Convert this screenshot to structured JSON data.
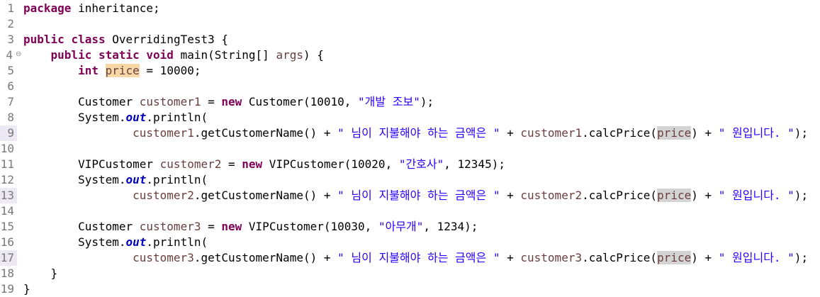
{
  "editor": {
    "lines": [
      {
        "num": "1",
        "tokens": [
          {
            "t": "package",
            "c": "kw"
          },
          {
            "t": " inheritance;",
            "c": ""
          }
        ]
      },
      {
        "num": "2",
        "tokens": []
      },
      {
        "num": "3",
        "tokens": [
          {
            "t": "public",
            "c": "kw"
          },
          {
            "t": " ",
            "c": ""
          },
          {
            "t": "class",
            "c": "kw"
          },
          {
            "t": " OverridingTest3 {",
            "c": ""
          }
        ]
      },
      {
        "num": "4",
        "fold": "⊖",
        "tokens": [
          {
            "t": "    ",
            "c": ""
          },
          {
            "t": "public",
            "c": "kw"
          },
          {
            "t": " ",
            "c": ""
          },
          {
            "t": "static",
            "c": "kw"
          },
          {
            "t": " ",
            "c": ""
          },
          {
            "t": "void",
            "c": "kw"
          },
          {
            "t": " main(String[] ",
            "c": ""
          },
          {
            "t": "args",
            "c": "var"
          },
          {
            "t": ") {",
            "c": ""
          }
        ]
      },
      {
        "num": "5",
        "tokens": [
          {
            "t": "        ",
            "c": ""
          },
          {
            "t": "int",
            "c": "kw"
          },
          {
            "t": " ",
            "c": ""
          },
          {
            "t": "price",
            "c": "var hl-decl"
          },
          {
            "t": " = 10000;",
            "c": ""
          }
        ]
      },
      {
        "num": "6",
        "tokens": []
      },
      {
        "num": "7",
        "tokens": [
          {
            "t": "        Customer ",
            "c": ""
          },
          {
            "t": "customer1",
            "c": "var"
          },
          {
            "t": " = ",
            "c": ""
          },
          {
            "t": "new",
            "c": "kw"
          },
          {
            "t": " Customer(10010, ",
            "c": ""
          },
          {
            "t": "\"개발 조보\"",
            "c": "str"
          },
          {
            "t": ");",
            "c": ""
          }
        ]
      },
      {
        "num": "8",
        "tokens": [
          {
            "t": "        System.",
            "c": ""
          },
          {
            "t": "out",
            "c": "fld"
          },
          {
            "t": ".println(",
            "c": ""
          }
        ]
      },
      {
        "num": "9",
        "marker": "full",
        "tokens": [
          {
            "t": "                ",
            "c": ""
          },
          {
            "t": "customer1",
            "c": "var"
          },
          {
            "t": ".getCustomerName() + ",
            "c": ""
          },
          {
            "t": "\" 님이 지불해야 하는 금액은 \"",
            "c": "str"
          },
          {
            "t": " + ",
            "c": ""
          },
          {
            "t": "customer1",
            "c": "var"
          },
          {
            "t": ".calcPrice(",
            "c": ""
          },
          {
            "t": "price",
            "c": "var hl"
          },
          {
            "t": ") + ",
            "c": ""
          },
          {
            "t": "\" 원입니다. \"",
            "c": "str"
          },
          {
            "t": ");",
            "c": ""
          }
        ]
      },
      {
        "num": "10",
        "tokens": []
      },
      {
        "num": "11",
        "tokens": [
          {
            "t": "        VIPCustomer ",
            "c": ""
          },
          {
            "t": "customer2",
            "c": "var"
          },
          {
            "t": " = ",
            "c": ""
          },
          {
            "t": "new",
            "c": "kw"
          },
          {
            "t": " VIPCustomer(10020, ",
            "c": ""
          },
          {
            "t": "\"간호사\"",
            "c": "str"
          },
          {
            "t": ", 12345);",
            "c": ""
          }
        ]
      },
      {
        "num": "12",
        "tokens": [
          {
            "t": "        System.",
            "c": ""
          },
          {
            "t": "out",
            "c": "fld"
          },
          {
            "t": ".println(",
            "c": ""
          }
        ]
      },
      {
        "num": "13",
        "marker": "full",
        "tokens": [
          {
            "t": "                ",
            "c": ""
          },
          {
            "t": "customer2",
            "c": "var"
          },
          {
            "t": ".getCustomerName() + ",
            "c": ""
          },
          {
            "t": "\" 님이 지불해야 하는 금액은 \"",
            "c": "str"
          },
          {
            "t": " + ",
            "c": ""
          },
          {
            "t": "customer2",
            "c": "var"
          },
          {
            "t": ".calcPrice(",
            "c": ""
          },
          {
            "t": "price",
            "c": "var hl"
          },
          {
            "t": ") + ",
            "c": ""
          },
          {
            "t": "\" 원입니다. \"",
            "c": "str"
          },
          {
            "t": ");",
            "c": ""
          }
        ]
      },
      {
        "num": "14",
        "tokens": []
      },
      {
        "num": "15",
        "tokens": [
          {
            "t": "        Customer ",
            "c": ""
          },
          {
            "t": "customer3",
            "c": "var"
          },
          {
            "t": " = ",
            "c": ""
          },
          {
            "t": "new",
            "c": "kw"
          },
          {
            "t": " VIPCustomer(10030, ",
            "c": ""
          },
          {
            "t": "\"아무개\"",
            "c": "str"
          },
          {
            "t": ", 1234);",
            "c": ""
          }
        ]
      },
      {
        "num": "16",
        "tokens": [
          {
            "t": "        System.",
            "c": ""
          },
          {
            "t": "out",
            "c": "fld"
          },
          {
            "t": ".println(",
            "c": ""
          }
        ]
      },
      {
        "num": "17",
        "marker": "full",
        "tokens": [
          {
            "t": "                ",
            "c": ""
          },
          {
            "t": "customer3",
            "c": "var"
          },
          {
            "t": ".getCustomerName() + ",
            "c": ""
          },
          {
            "t": "\" 님이 지불해야 하는 금액은 \"",
            "c": "str"
          },
          {
            "t": " + ",
            "c": ""
          },
          {
            "t": "customer3",
            "c": "var"
          },
          {
            "t": ".calcPrice(",
            "c": ""
          },
          {
            "t": "price",
            "c": "var hl"
          },
          {
            "t": ") + ",
            "c": ""
          },
          {
            "t": "\" 원입니다. \"",
            "c": "str"
          },
          {
            "t": ");",
            "c": ""
          }
        ]
      },
      {
        "num": "18",
        "tokens": [
          {
            "t": "    }",
            "c": ""
          }
        ]
      },
      {
        "num": "19",
        "tokens": [
          {
            "t": "}",
            "c": ""
          }
        ]
      }
    ]
  },
  "colors": {
    "keyword": "#7f0055",
    "string": "#2a00ff",
    "local_variable": "#6a3e3e",
    "static_field": "#0000c0",
    "occurrence_highlight": "#d4d4d4",
    "declaration_highlight": "#f7d7a6"
  },
  "icons": {
    "fold": "collapse-fold-icon"
  }
}
